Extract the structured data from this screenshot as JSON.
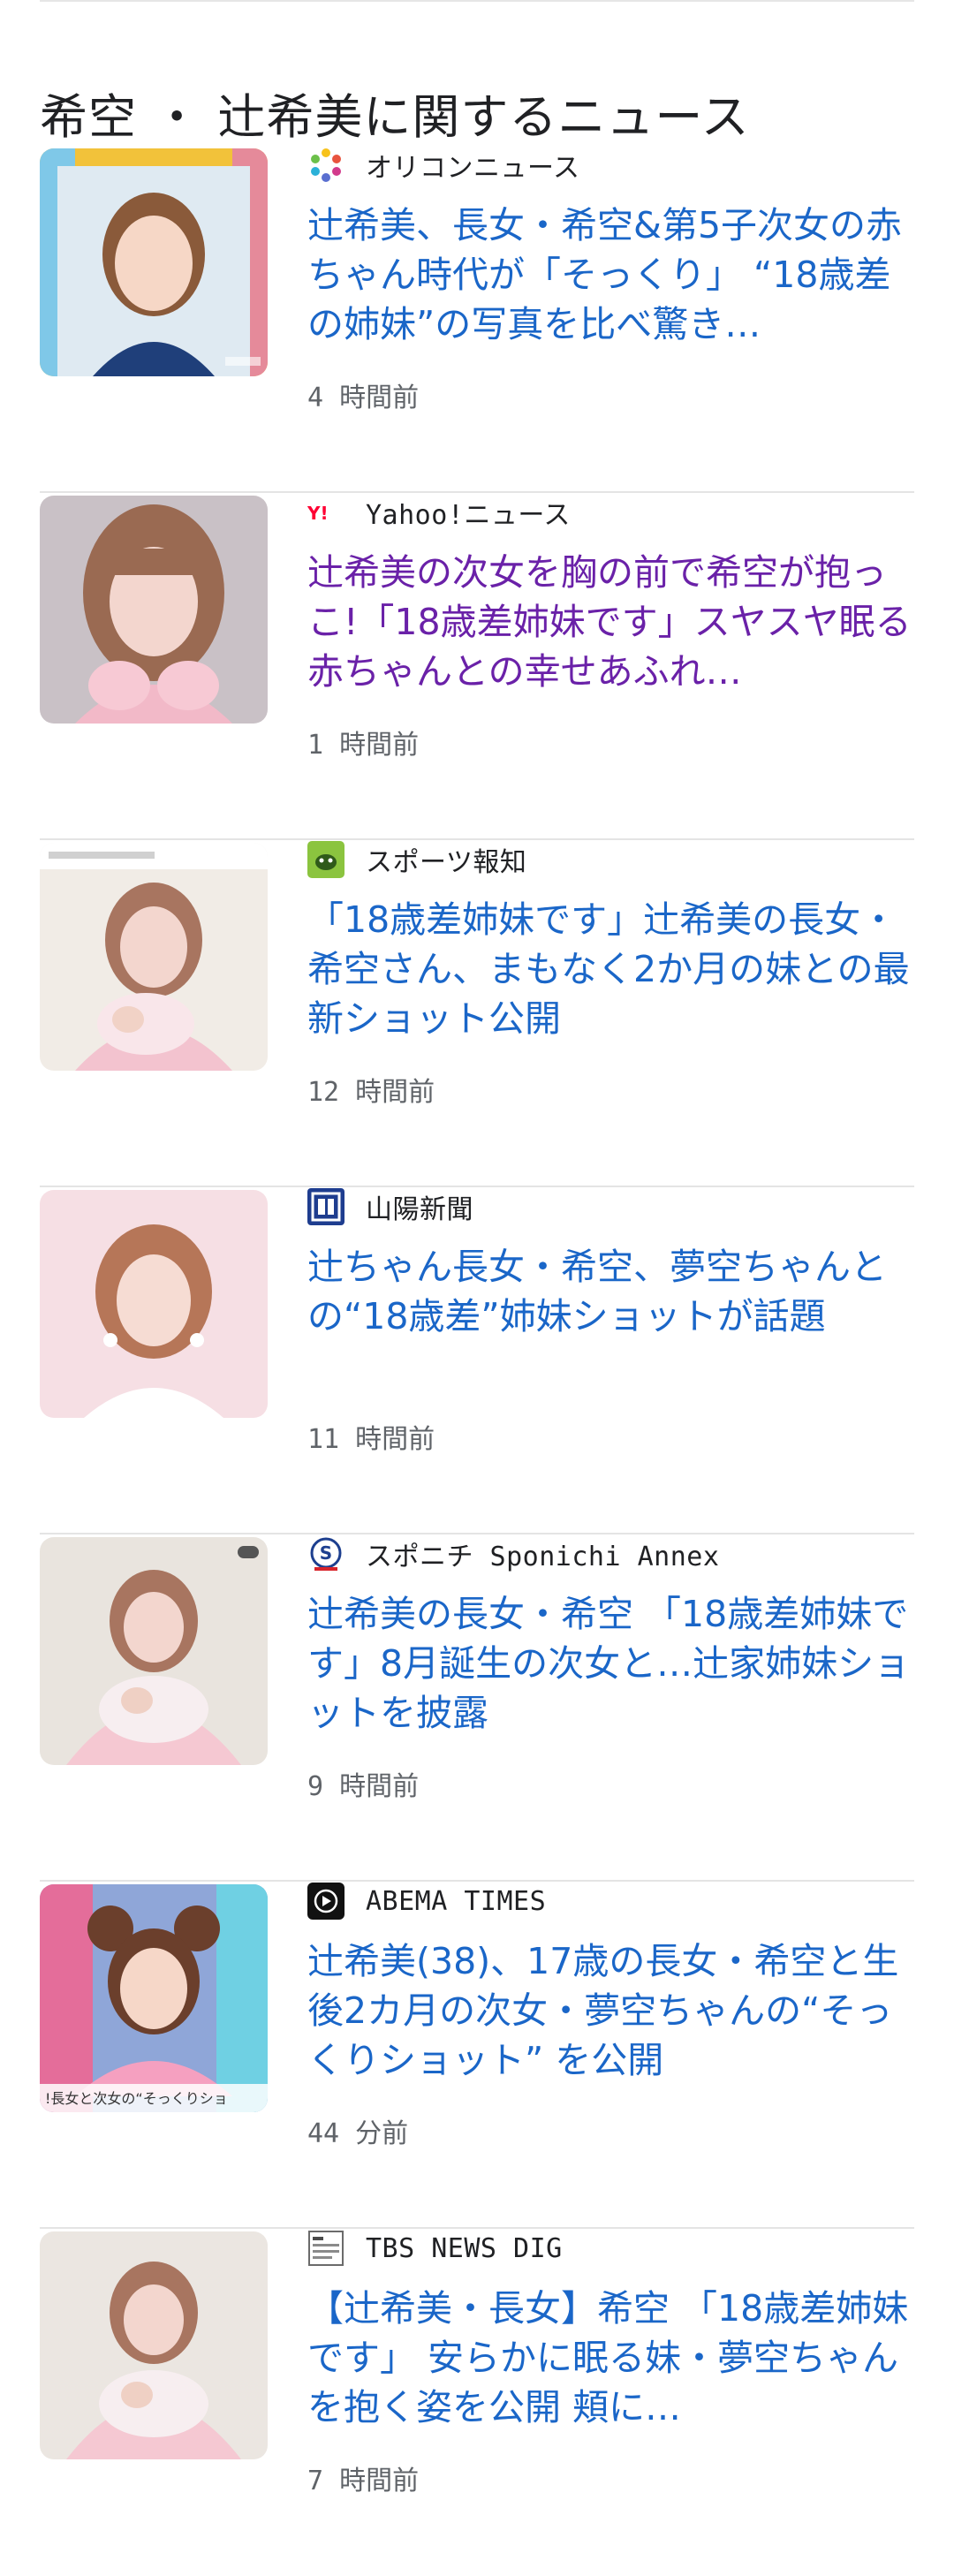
{
  "section": {
    "title": "希空 ・ 辻希美に関するニュース"
  },
  "articles": [
    {
      "source": "オリコンニュース",
      "logo_icon": "oricon-logo-icon",
      "headline": "辻希美、長女・希空&第5子次女の赤ちゃん時代が「そっくり」 “18歳差の姉妹”の写真を比べ驚き…",
      "time": "4 時間前",
      "thumbnail_icon": "woman-portrait-thumbnail",
      "visited": false
    },
    {
      "source": "Yahoo!ニュース",
      "logo_icon": "yahoo-logo-icon",
      "headline": "辻希美の次女を胸の前で希空が抱っこ!「18歳差姉妹です」スヤスヤ眠る赤ちゃんとの幸せあふれ…",
      "time": "1 時間前",
      "thumbnail_icon": "woman-portrait-thumbnail",
      "visited": true
    },
    {
      "source": "スポーツ報知",
      "logo_icon": "hochi-logo-icon",
      "headline": "「18歳差姉妹です」辻希美の長女・希空さん、まもなく2か月の妹との最新ショット公開",
      "time": "12 時間前",
      "thumbnail_icon": "woman-with-baby-thumbnail",
      "visited": false
    },
    {
      "source": "山陽新聞",
      "logo_icon": "sanyo-logo-icon",
      "headline": "辻ちゃん長女・希空、夢空ちゃんとの“18歳差”姉妹ショットが話題",
      "time": "11 時間前",
      "thumbnail_icon": "woman-portrait-thumbnail",
      "visited": false
    },
    {
      "source": "スポニチ Sponichi Annex",
      "logo_icon": "sponichi-logo-icon",
      "headline": "辻希美の長女・希空 「18歳差姉妹です」8月誕生の次女と…辻家姉妹ショットを披露",
      "time": "9 時間前",
      "thumbnail_icon": "woman-with-baby-thumbnail",
      "visited": false
    },
    {
      "source": "ABEMA TIMES",
      "logo_icon": "abema-logo-icon",
      "headline": "辻希美(38)、17歳の長女・希空と生後2カ月の次女・夢空ちゃんの“そっくりショット” を公開",
      "time": "44 分前",
      "thumbnail_icon": "woman-portrait-thumbnail",
      "thumbnail_caption": "!長女と次女の“そっくりショ",
      "visited": false
    },
    {
      "source": "TBS NEWS DIG",
      "logo_icon": "tbs-logo-icon",
      "headline": "【辻希美・長女】希空 「18歳差姉妹です」 安らかに眠る妹・夢空ちゃんを抱く姿を公開 頬に…",
      "time": "7 時間前",
      "thumbnail_icon": "woman-with-baby-thumbnail",
      "visited": false
    }
  ],
  "colors": {
    "link": "#1a66c8",
    "visited_link": "#6a21a8",
    "meta_text": "#5f6368",
    "divider": "#e4e4e4"
  }
}
